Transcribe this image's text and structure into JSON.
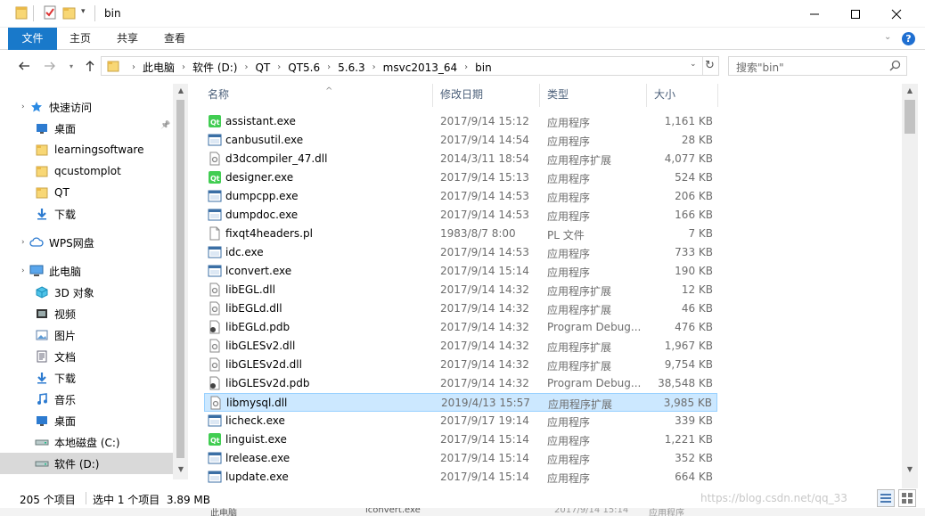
{
  "window": {
    "title": "bin"
  },
  "ribbon": {
    "tabs": [
      "文件",
      "主页",
      "共享",
      "查看"
    ]
  },
  "address": {
    "crumbs": [
      "此电脑",
      "软件 (D:)",
      "QT",
      "QT5.6",
      "5.6.3",
      "msvc2013_64",
      "bin"
    ],
    "search_placeholder": "搜索\"bin\""
  },
  "nav": {
    "items": [
      {
        "label": "快速访问",
        "icon": "star-icon",
        "level": 0
      },
      {
        "label": "桌面",
        "icon": "desktop-icon",
        "level": 1,
        "pinned": true
      },
      {
        "label": "learningsoftware",
        "icon": "folder-icon",
        "level": 1
      },
      {
        "label": "qcustomplot",
        "icon": "folder-icon",
        "level": 1
      },
      {
        "label": "QT",
        "icon": "folder-icon",
        "level": 1
      },
      {
        "label": "下载",
        "icon": "download-icon",
        "level": 1
      },
      {
        "label": "WPS网盘",
        "icon": "cloud-icon",
        "level": 0
      },
      {
        "label": "此电脑",
        "icon": "computer-icon",
        "level": 0
      },
      {
        "label": "3D 对象",
        "icon": "cube-icon",
        "level": 1
      },
      {
        "label": "视频",
        "icon": "video-icon",
        "level": 1
      },
      {
        "label": "图片",
        "icon": "picture-icon",
        "level": 1
      },
      {
        "label": "文档",
        "icon": "document-icon",
        "level": 1
      },
      {
        "label": "下载",
        "icon": "download-icon",
        "level": 1
      },
      {
        "label": "音乐",
        "icon": "music-icon",
        "level": 1
      },
      {
        "label": "桌面",
        "icon": "desktop-icon",
        "level": 1
      },
      {
        "label": "本地磁盘 (C:)",
        "icon": "drive-icon",
        "level": 1
      },
      {
        "label": "软件 (D:)",
        "icon": "drive-icon",
        "level": 1,
        "selected": true
      }
    ]
  },
  "columns": {
    "name": "名称",
    "date": "修改日期",
    "type": "类型",
    "size": "大小"
  },
  "files": [
    {
      "name": "assistant.exe",
      "date": "2017/9/14 15:12",
      "type": "应用程序",
      "size": "1,161 KB",
      "icon": "qt-exe-icon"
    },
    {
      "name": "canbusutil.exe",
      "date": "2017/9/14 14:54",
      "type": "应用程序",
      "size": "28 KB",
      "icon": "exe-icon"
    },
    {
      "name": "d3dcompiler_47.dll",
      "date": "2014/3/11 18:54",
      "type": "应用程序扩展",
      "size": "4,077 KB",
      "icon": "dll-icon"
    },
    {
      "name": "designer.exe",
      "date": "2017/9/14 15:13",
      "type": "应用程序",
      "size": "524 KB",
      "icon": "qt-exe-icon"
    },
    {
      "name": "dumpcpp.exe",
      "date": "2017/9/14 14:53",
      "type": "应用程序",
      "size": "206 KB",
      "icon": "exe-icon"
    },
    {
      "name": "dumpdoc.exe",
      "date": "2017/9/14 14:53",
      "type": "应用程序",
      "size": "166 KB",
      "icon": "exe-icon"
    },
    {
      "name": "fixqt4headers.pl",
      "date": "1983/8/7 8:00",
      "type": "PL 文件",
      "size": "7 KB",
      "icon": "file-icon"
    },
    {
      "name": "idc.exe",
      "date": "2017/9/14 14:53",
      "type": "应用程序",
      "size": "733 KB",
      "icon": "exe-icon"
    },
    {
      "name": "lconvert.exe",
      "date": "2017/9/14 15:14",
      "type": "应用程序",
      "size": "190 KB",
      "icon": "exe-icon"
    },
    {
      "name": "libEGL.dll",
      "date": "2017/9/14 14:32",
      "type": "应用程序扩展",
      "size": "12 KB",
      "icon": "dll-icon"
    },
    {
      "name": "libEGLd.dll",
      "date": "2017/9/14 14:32",
      "type": "应用程序扩展",
      "size": "46 KB",
      "icon": "dll-icon"
    },
    {
      "name": "libEGLd.pdb",
      "date": "2017/9/14 14:32",
      "type": "Program Debug...",
      "size": "476 KB",
      "icon": "pdb-icon"
    },
    {
      "name": "libGLESv2.dll",
      "date": "2017/9/14 14:32",
      "type": "应用程序扩展",
      "size": "1,967 KB",
      "icon": "dll-icon"
    },
    {
      "name": "libGLESv2d.dll",
      "date": "2017/9/14 14:32",
      "type": "应用程序扩展",
      "size": "9,754 KB",
      "icon": "dll-icon"
    },
    {
      "name": "libGLESv2d.pdb",
      "date": "2017/9/14 14:32",
      "type": "Program Debug...",
      "size": "38,548 KB",
      "icon": "pdb-icon"
    },
    {
      "name": "libmysql.dll",
      "date": "2019/4/13 15:57",
      "type": "应用程序扩展",
      "size": "3,985 KB",
      "icon": "dll-icon",
      "selected": true
    },
    {
      "name": "licheck.exe",
      "date": "2017/9/17 19:14",
      "type": "应用程序",
      "size": "339 KB",
      "icon": "exe-icon"
    },
    {
      "name": "linguist.exe",
      "date": "2017/9/14 15:14",
      "type": "应用程序",
      "size": "1,221 KB",
      "icon": "qt-exe-icon"
    },
    {
      "name": "lrelease.exe",
      "date": "2017/9/14 15:14",
      "type": "应用程序",
      "size": "352 KB",
      "icon": "exe-icon"
    },
    {
      "name": "lupdate.exe",
      "date": "2017/9/14 15:14",
      "type": "应用程序",
      "size": "664 KB",
      "icon": "exe-icon"
    }
  ],
  "status": {
    "count": "205 个项目",
    "selection": "选中 1 个项目  3.89 MB"
  },
  "watermark": "https://blog.csdn.net/qq_33",
  "behind_window": {
    "file": "lconvert.exe",
    "date": "2017/9/14 15:14",
    "type": "应用程序",
    "drive": "此电脑"
  },
  "colors": {
    "accent": "#1979ca",
    "selection_bg": "#cce8ff",
    "selection_border": "#99d1ff",
    "folder": "#f8d775"
  }
}
